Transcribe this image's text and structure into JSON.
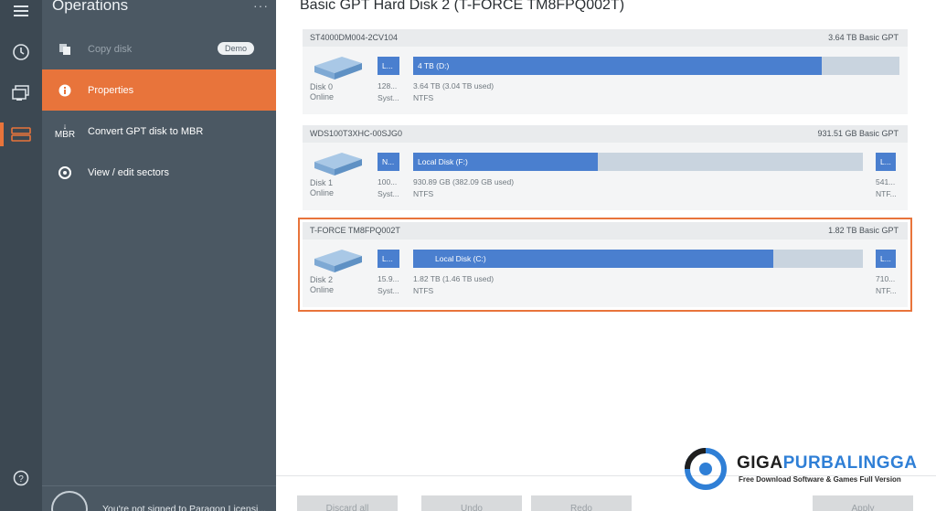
{
  "operations": {
    "title": "Operations",
    "more_label": "···",
    "items": [
      {
        "label": "Copy disk",
        "badge": "Demo"
      },
      {
        "label": "Properties"
      },
      {
        "label": "Convert GPT disk to MBR",
        "icon_text": "MBR"
      },
      {
        "label": "View / edit sectors"
      }
    ],
    "user_status": "You're not signed to Paragon Licensi..."
  },
  "rail": {
    "icons": [
      "menu-icon",
      "history-icon",
      "monitor-icon",
      "disks-icon",
      "help-icon"
    ]
  },
  "main": {
    "title": "Basic GPT Hard Disk 2 (T-FORCE TM8FPQ002T)",
    "disks": [
      {
        "name": "ST4000DM004-2CV104",
        "info": "3.64 TB Basic GPT",
        "disk_label": "Disk 0",
        "status": "Online",
        "small_part": {
          "label": "L...",
          "size": "128...",
          "fs": "Syst..."
        },
        "main_part": {
          "label": "4 TB (D:)",
          "size": "3.64 TB (3.04 TB used)",
          "fs": "NTFS",
          "used_fraction": 0.84
        }
      },
      {
        "name": "WDS100T3XHC-00SJG0",
        "info": "931.51 GB Basic GPT",
        "disk_label": "Disk 1",
        "status": "Online",
        "small_part": {
          "label": "N...",
          "size": "100...",
          "fs": "Syst..."
        },
        "main_part": {
          "label": "Local Disk (F:)",
          "size": "930.89 GB (382.09 GB used)",
          "fs": "NTFS",
          "used_fraction": 0.41
        },
        "end_part": {
          "label": "L...",
          "size": "541...",
          "fs": "NTF..."
        }
      },
      {
        "name": "T-FORCE TM8FPQ002T",
        "info": "1.82 TB Basic GPT",
        "disk_label": "Disk 2",
        "status": "Online",
        "small_part": {
          "label": "L...",
          "size": "15.9...",
          "fs": "Syst..."
        },
        "main_part": {
          "label": "Local Disk (C:)",
          "size": "1.82 TB (1.46 TB used)",
          "fs": "NTFS",
          "used_fraction": 0.8
        },
        "end_part": {
          "label": "L...",
          "size": "710...",
          "fs": "NTF..."
        }
      }
    ]
  },
  "buttons": {
    "discard": "Discard all",
    "undo": "Undo",
    "redo": "Redo",
    "apply": "Apply"
  },
  "watermark": {
    "brand_a": "GIGA",
    "brand_b": "PURBALINGGA",
    "tagline": "Free Download Software & Games Full Version"
  },
  "colors": {
    "accent": "#e8743b",
    "partition_fill": "#4a7fcf",
    "partition_free": "#c9d4df",
    "sidebar": "#4b5863",
    "rail": "#3c4852"
  }
}
